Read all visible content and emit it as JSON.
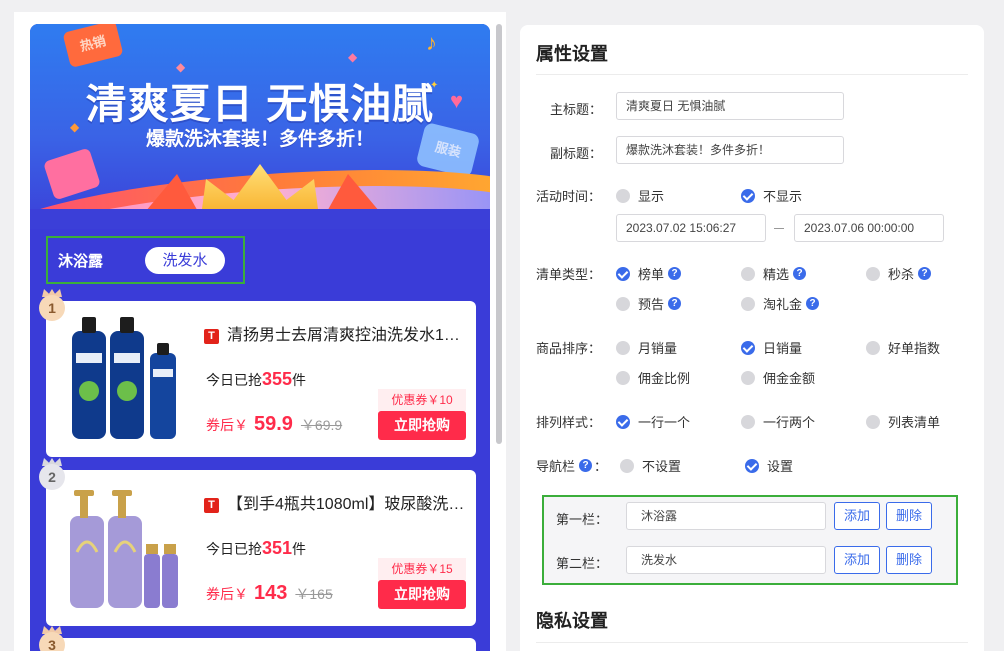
{
  "preview": {
    "banner": {
      "title": "清爽夏日 无惧油腻",
      "subtitle": "爆款洗沐套装！多件多折！",
      "tag_hot": "热销",
      "tag_cloth": "服装"
    },
    "nav": {
      "tab1": "沐浴露",
      "tab2": "洗发水"
    },
    "products": [
      {
        "rank": "1",
        "platform_icon": "T",
        "name": "清扬男士去屑清爽控油洗发水1…",
        "sold_prefix": "今日已抢",
        "sold": "355",
        "sold_suffix": "件",
        "price_prefix": "券后￥",
        "price": "59.9",
        "orig_price": "￥69.9",
        "coupon": "优惠券￥10",
        "buy": "立即抢购"
      },
      {
        "rank": "2",
        "platform_icon": "T",
        "name": "【到手4瓶共1080ml】玻尿酸洗…",
        "sold_prefix": "今日已抢",
        "sold": "351",
        "sold_suffix": "件",
        "price_prefix": "券后￥",
        "price": "143",
        "orig_price": "￥165",
        "coupon": "优惠券￥15",
        "buy": "立即抢购"
      },
      {
        "rank": "3"
      }
    ]
  },
  "settings": {
    "section_title": "属性设置",
    "main_title_label": "主标题：",
    "main_title_value": "清爽夏日 无惧油腻",
    "sub_title_label": "副标题：",
    "sub_title_value": "爆款洗沐套装！多件多折！",
    "time_label": "活动时间：",
    "time_show": "显示",
    "time_hide": "不显示",
    "time_start": "2023.07.02 15:06:27",
    "time_sep": "—",
    "time_end": "2023.07.06 00:00:00",
    "list_type_label": "清单类型：",
    "list_types": [
      "榜单",
      "精选",
      "秒杀",
      "预告",
      "淘礼金"
    ],
    "sort_label": "商品排序：",
    "sorts": [
      "月销量",
      "日销量",
      "好单指数",
      "佣金比例",
      "佣金金额"
    ],
    "layout_label": "排列样式：",
    "layouts": [
      "一行一个",
      "一行两个",
      "列表清单"
    ],
    "navbar_label": "导航栏",
    "navbar_colon": "：",
    "navbar_off": "不设置",
    "navbar_on": "设置",
    "nav_rows": [
      {
        "label": "第一栏：",
        "value": "沐浴露",
        "add": "添加",
        "del": "删除"
      },
      {
        "label": "第二栏：",
        "value": "洗发水",
        "add": "添加",
        "del": "删除"
      }
    ],
    "privacy_title": "隐私设置"
  },
  "colors": {
    "accent": "#3a6bea",
    "highlight_box": "#3bae3b",
    "price_red": "#ff2b4a",
    "preview_bg": "#3a3cd8"
  }
}
